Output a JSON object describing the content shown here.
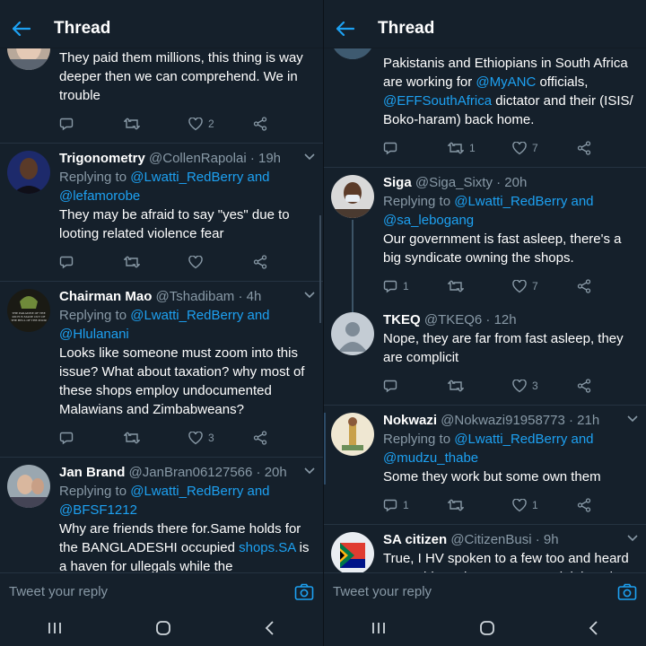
{
  "left": {
    "title": "Thread",
    "reply_placeholder": "Tweet your reply",
    "tweets": [
      {
        "body": "They paid them millions, this thing is way deeper then we can comprehend. We in trouble",
        "replies": "",
        "retweets": "",
        "likes": "2"
      },
      {
        "name": "Trigonometry",
        "handle": "@CollenRapolai · 19h",
        "replying": "Replying to",
        "mention1": "@Lwatti_RedBerry and",
        "mention2": "@lefamorobe",
        "body": "They may be afraid to say \"yes\" due to looting related violence fear",
        "replies": "",
        "retweets": "",
        "likes": ""
      },
      {
        "name": "Chairman Mao",
        "handle": "@Tshadibam · 4h",
        "replying": "Replying to",
        "mention1": "@Lwatti_RedBerry and",
        "mention2": "@Hlulanani",
        "body": "Looks like someone must zoom into this issue? What about taxation? why most of these shops employ undocumented Malawians and Zimbabweans?",
        "replies": "",
        "retweets": "",
        "likes": "3",
        "avatar_text": "THE PARADISE OF THE RICH IS MADE OUT OF THE HELL OF THE POOR"
      },
      {
        "name": "Jan Brand",
        "handle": "@JanBran06127566 · 20h",
        "replying": "Replying to",
        "mention1": "@Lwatti_RedBerry and",
        "mention2": "@BFSF1212",
        "body_a": "Why are friends there for.Same holds for the BANGLADESHI occupied",
        "body_link": "shops.SA",
        "body_b": "is a haven for ullegals while the politiciansand deployees make hay even when the sun does not shine 😂"
      }
    ]
  },
  "right": {
    "title": "Thread",
    "reply_placeholder": "Tweet your reply",
    "tweets": [
      {
        "body_a": "Pakistanis and Ethiopians in South Africa are working for",
        "link1": "@MyANC",
        "body_b": "officials,",
        "link2": "@EFFSouthAfrica",
        "body_c": "dictator and their (ISIS/ Boko-haram) back home.",
        "replies": "",
        "retweets": "1",
        "likes": "7"
      },
      {
        "name": "Siga",
        "handle": "@Siga_Sixty · 20h",
        "replying": "Replying to",
        "mention1": "@Lwatti_RedBerry and",
        "mention2": "@sa_lebogang",
        "body": "Our government is fast asleep, there's a big syndicate owning the shops.",
        "replies": "1",
        "retweets": "",
        "likes": "7"
      },
      {
        "name": "TKEQ",
        "handle": "@TKEQ6 · 12h",
        "body": "Nope, they are far from fast asleep, they are complicit",
        "replies": "",
        "retweets": "",
        "likes": "3"
      },
      {
        "name": "Nokwazi",
        "handle": "@Nokwazi91958773 · 21h",
        "replying": "Replying to",
        "mention1": "@Lwatti_RedBerry and",
        "mention2": "@mudzu_thabe",
        "body": "Some they work but some own them",
        "replies": "1",
        "retweets": "",
        "likes": "1"
      },
      {
        "name": "SA citizen",
        "handle": "@CitizenBusi · 9h",
        "body": "True, I HV spoken to a few too and heard same thing others even complaining about working conditions b are afraid of their so called boss"
      }
    ]
  },
  "colors": {
    "background": "#15202b",
    "accent": "#1da1f2",
    "muted": "#8899a6",
    "divider": "#253341"
  }
}
